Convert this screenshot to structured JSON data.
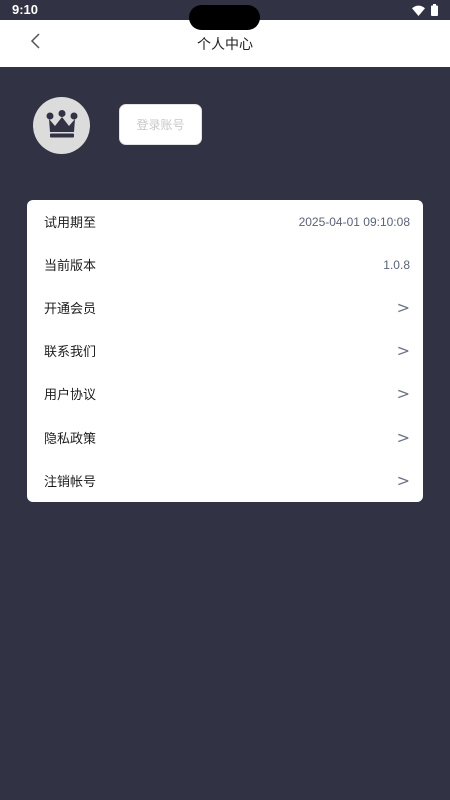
{
  "status_bar": {
    "time": "9:10",
    "wifi_icon": "wifi-icon",
    "battery_icon": "battery-icon"
  },
  "header": {
    "title": "个人中心",
    "back_icon": "chevron-left-icon"
  },
  "profile": {
    "avatar_icon": "crown-icon",
    "login_label": "登录账号"
  },
  "menu": {
    "items": [
      {
        "label": "试用期至",
        "value": "2025-04-01 09:10:08"
      },
      {
        "label": "当前版本",
        "value": "1.0.8"
      },
      {
        "label": "开通会员",
        "arrow": ">"
      },
      {
        "label": "联系我们",
        "arrow": ">"
      },
      {
        "label": "用户协议",
        "arrow": ">"
      },
      {
        "label": "隐私政策",
        "arrow": ">"
      },
      {
        "label": "注销帐号",
        "arrow": ">"
      }
    ]
  },
  "colors": {
    "background": "#313244",
    "card": "#ffffff",
    "avatar_bg": "#dcdcdc"
  }
}
